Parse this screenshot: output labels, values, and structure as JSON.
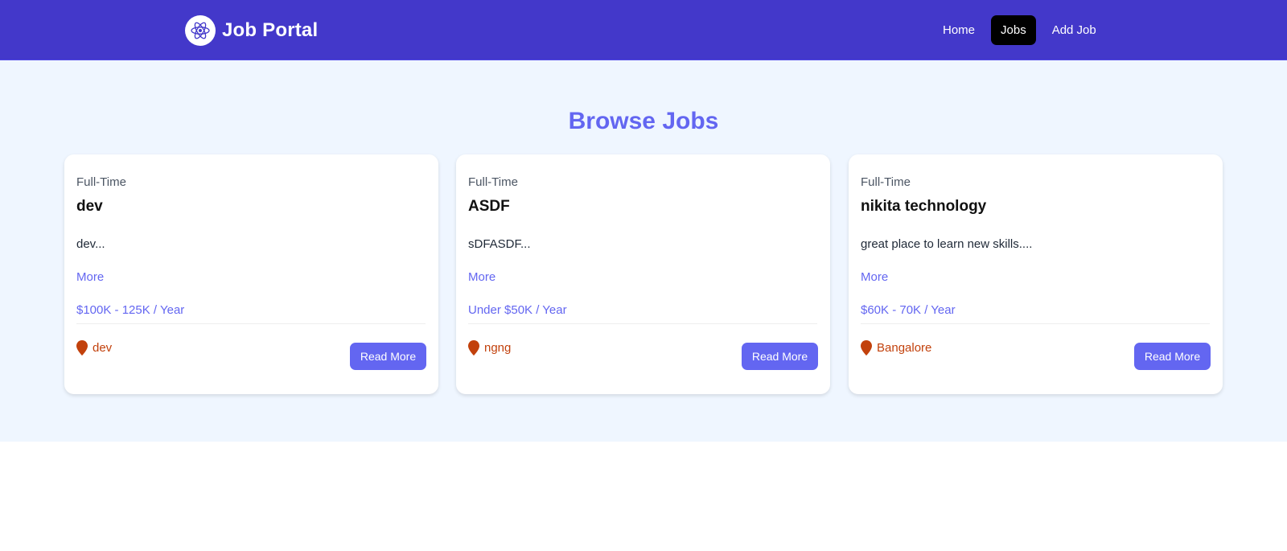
{
  "nav": {
    "brand": "Job Portal",
    "logo_icon": "react-atom-icon",
    "links": [
      "Home",
      "Jobs",
      "Add Job"
    ],
    "active": "Jobs"
  },
  "main": {
    "title": "Browse Jobs"
  },
  "jobs": [
    {
      "type": "Full-Time",
      "title": "dev",
      "description": "dev...",
      "more_label": "More",
      "salary": "$100K - 125K / Year",
      "location": "dev",
      "location_icon": "map-marker-icon",
      "button_label": "Read More"
    },
    {
      "type": "Full-Time",
      "title": "ASDF",
      "description": "sDFASDF...",
      "more_label": "More",
      "salary": "Under $50K / Year",
      "location": "ngng",
      "location_icon": "map-marker-icon",
      "button_label": "Read More"
    },
    {
      "type": "Full-Time",
      "title": "nikita technology",
      "description": "great place to learn new skills....",
      "more_label": "More",
      "salary": "$60K - 70K / Year",
      "location": "Bangalore",
      "location_icon": "map-marker-icon",
      "button_label": "Read More"
    }
  ],
  "colors": {
    "navbar": "#4338ca",
    "accent": "#6366f1",
    "location": "#c2410c",
    "page_bg": "#eff6ff"
  }
}
